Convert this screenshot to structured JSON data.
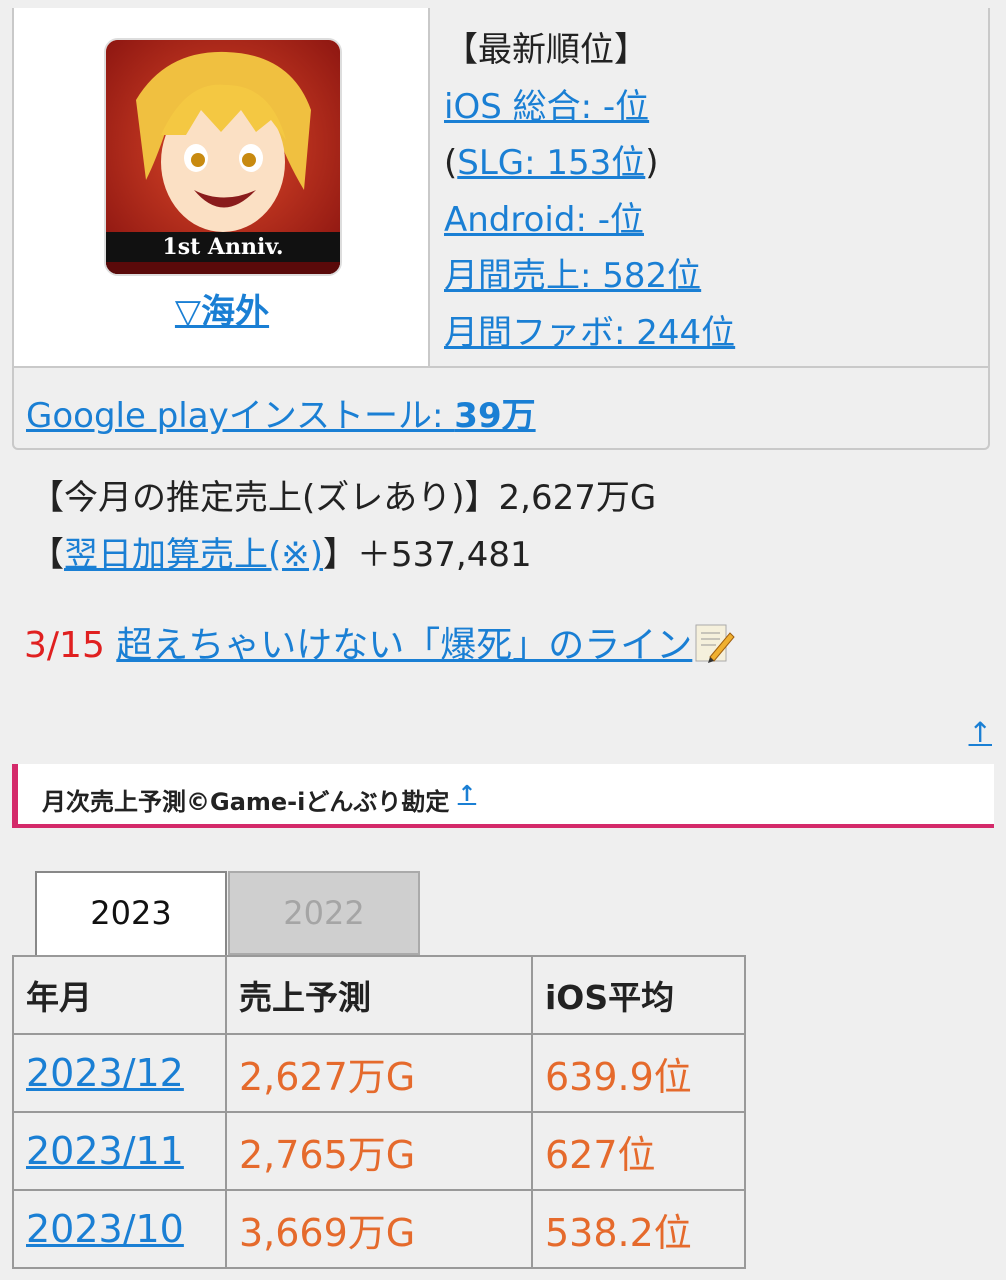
{
  "game": {
    "icon_name": "character-app-icon",
    "icon_badge": "1st Anniv.",
    "overseas_link": "▽海外"
  },
  "ranking": {
    "heading": "【最新順位】",
    "ios_overall": "iOS 総合: -位",
    "slg_open": "(",
    "slg": "SLG: 153位",
    "slg_close": ")",
    "android": "Android: -位",
    "monthly_sales": "月間売上: 582位",
    "monthly_fav": "月間ファボ: 244位"
  },
  "install": {
    "label": "Google playインストール: ",
    "value": "39万"
  },
  "estimate": {
    "monthly_label": "【今月の推定売上(ズレあり)】2,627万G",
    "next_day_prefix": "【",
    "next_day_link": "翌日加算売上(※)",
    "next_day_suffix": "】＋537,481"
  },
  "news": {
    "date": "3/15",
    "title": "超えちゃいけない「爆死」のライン",
    "icon_name": "memo-pencil-icon"
  },
  "nav": {
    "up_arrow": "↑"
  },
  "section": {
    "title": "月次売上予測©Game-iどんぶり勘定",
    "anchor": "↑"
  },
  "tabs": [
    {
      "label": "2023",
      "active": true
    },
    {
      "label": "2022",
      "active": false
    }
  ],
  "table": {
    "headers": [
      "年月",
      "売上予測",
      "iOS平均"
    ],
    "rows": [
      [
        "2023/12",
        "2,627万G",
        "639.9位"
      ],
      [
        "2023/11",
        "2,765万G",
        "627位"
      ],
      [
        "2023/10",
        "3,669万G",
        "538.2位"
      ]
    ]
  },
  "colors": {
    "link": "#1a7fd4",
    "accent_pink": "#d42a6a",
    "value_orange": "#e56a2c",
    "date_red": "#e02020"
  }
}
